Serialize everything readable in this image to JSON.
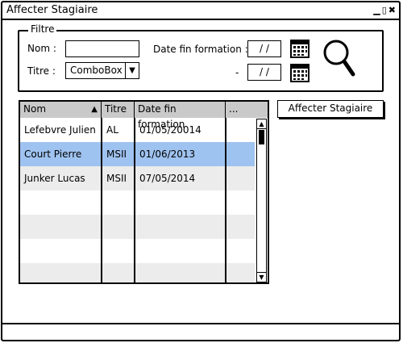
{
  "window": {
    "title": "Affecter Stagiaire"
  },
  "filter": {
    "legend": "Filtre",
    "nom_label": "Nom :",
    "nom_value": "",
    "titre_label": "Titre :",
    "titre_value": "ComboBox",
    "date_label": "Date fin formation :",
    "date_from": "/ /",
    "dash": "-",
    "date_to": "/ /"
  },
  "table": {
    "columns": [
      "Nom",
      "Titre",
      "Date fin formation",
      "..."
    ],
    "sort_column": "Nom",
    "rows": [
      {
        "nom": "Lefebvre Julien",
        "titre": "AL",
        "date": "01/05/20014",
        "extra": ""
      },
      {
        "nom": "Court Pierre",
        "titre": "MSII",
        "date": "01/06/2013",
        "extra": ""
      },
      {
        "nom": "Junker Lucas",
        "titre": "MSII",
        "date": "07/05/2014",
        "extra": ""
      }
    ],
    "selected_row": 1
  },
  "actions": {
    "affecter_label": "Affecter Stagiaire"
  },
  "colors": {
    "selected_row": "#9fc3f0",
    "header": "#c9c9c9",
    "alt_row": "#ececec"
  }
}
